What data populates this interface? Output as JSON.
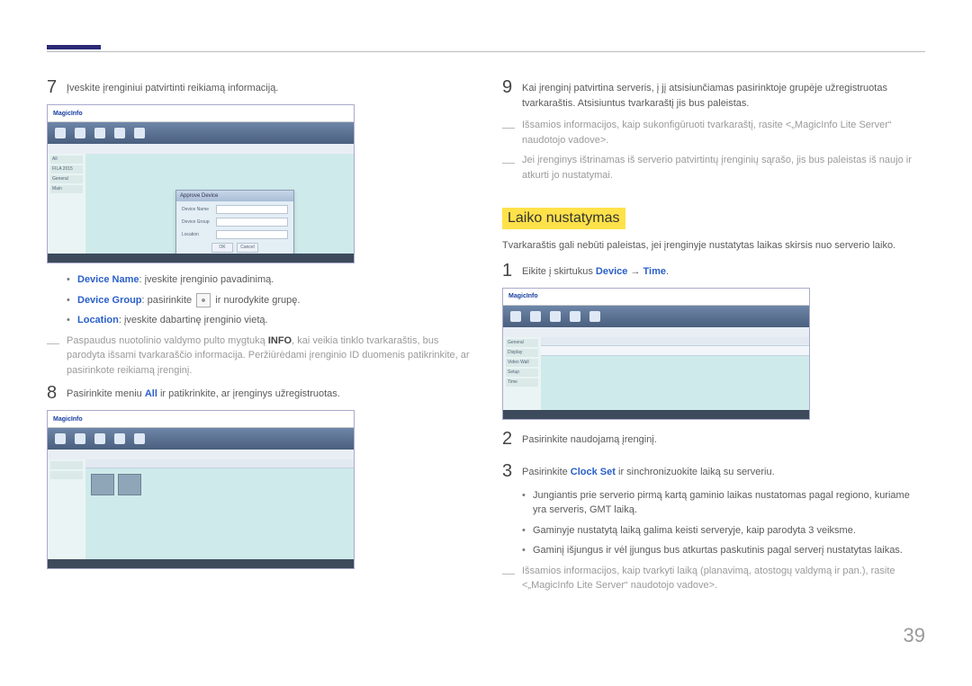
{
  "page_number": "39",
  "left": {
    "step7_text": "Įveskite įrenginiui patvirtinti reikiamą informaciją.",
    "bullets": [
      {
        "label": "Device Name",
        "text": ": įveskite įrenginio pavadinimą."
      },
      {
        "label": "Device Group",
        "text": ": pasirinkite ",
        "tail": " ir nurodykite grupę."
      },
      {
        "label": "Location",
        "text": ": įveskite dabartinę įrenginio vietą."
      }
    ],
    "note": {
      "pre": "Paspaudus nuotolinio valdymo pulto mygtuką ",
      "bold": "INFO",
      "post": ", kai veikia tinklo tvarkaraštis, bus parodyta išsami tvarkaraščio informacija. Peržiūrėdami įrenginio ID duomenis patikrinkite, ar pasirinkote reikiamą įrenginį."
    },
    "step8_pre": "Pasirinkite meniu ",
    "step8_bold": "All",
    "step8_post": " ir patikrinkite, ar įrenginys užregistruotas.",
    "ss1": {
      "logo": "MagicInfo",
      "side": [
        "All",
        "FILA 2015",
        "General",
        "Main"
      ],
      "dialog_title": "Approve Device",
      "fields": [
        "Device Name",
        "Device Group",
        "Location"
      ],
      "ok": "OK",
      "cancel": "Cancel"
    },
    "ss2": {
      "logo": "MagicInfo"
    }
  },
  "right": {
    "step9_text": "Kai įrenginį patvirtina serveris, į jį atsisiunčiamas pasirinktoje grupėje užregistruotas tvarkaraštis. Atsisiuntus tvarkaraštį jis bus paleistas.",
    "notes": [
      "Išsamios informacijos, kaip sukonfigūruoti tvarkaraštį, rasite <„MagicInfo Lite Server“ naudotojo vadove>.",
      "Jei įrenginys ištrinamas iš serverio patvirtintų įrenginių sąrašo, jis bus paleistas iš naujo ir atkurti jo nustatymai."
    ],
    "section_title": "Laiko nustatymas",
    "intro": "Tvarkaraštis gali nebūti paleistas, jei įrenginyje nustatytas laikas skirsis nuo serverio laiko.",
    "step1_pre": "Eikite į skirtukus ",
    "step1_b1": "Device",
    "step1_arrow": " → ",
    "step1_b2": "Time",
    "step1_post": ".",
    "step2_text": "Pasirinkite naudojamą įrenginį.",
    "step3_pre": "Pasirinkite ",
    "step3_bold": "Clock Set",
    "step3_post": " ir sinchronizuokite laiką su serveriu.",
    "bullets2": [
      "Jungiantis prie serverio pirmą kartą gaminio laikas nustatomas pagal regiono, kuriame yra serveris, GMT laiką.",
      "Gaminyje nustatytą laiką galima keisti serveryje, kaip parodyta 3 veiksme.",
      "Gaminį išjungus ir vėl įjungus bus atkurtas paskutinis pagal serverį nustatytas laikas."
    ],
    "note2": "Išsamios informacijos, kaip tvarkyti laiką (planavimą, atostogų valdymą ir pan.), rasite <„MagicInfo Lite Server“ naudotojo vadove>.",
    "ss3": {
      "logo": "MagicInfo",
      "side": [
        "General",
        "Display",
        "Video Wall",
        "Setup",
        "Time"
      ]
    }
  }
}
